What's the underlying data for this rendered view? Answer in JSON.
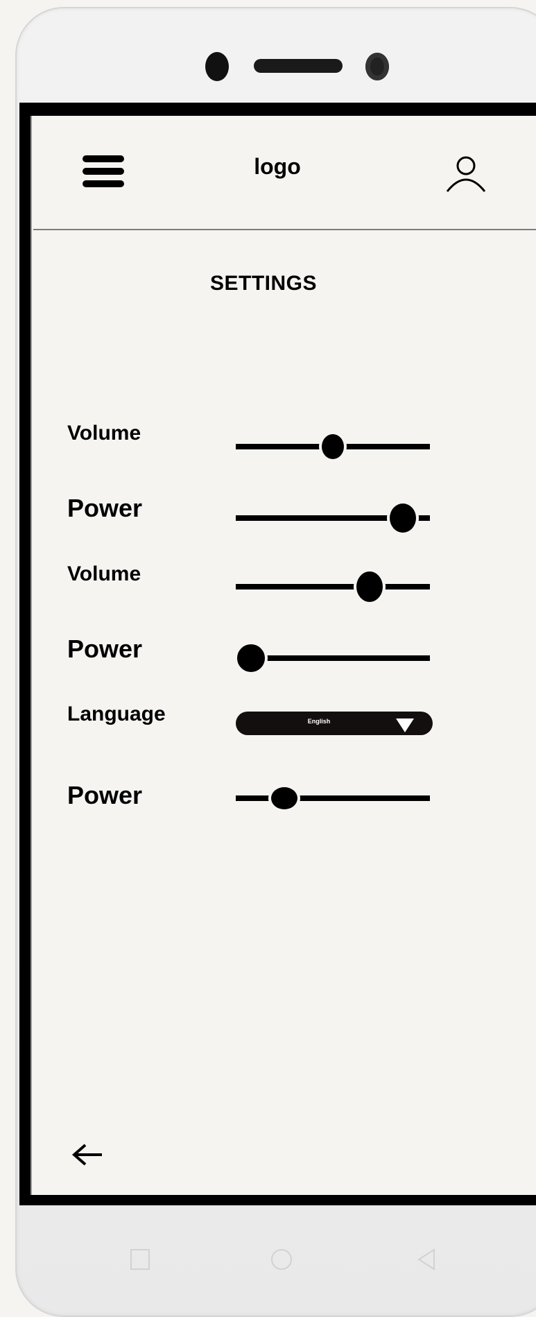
{
  "header": {
    "logo": "logo"
  },
  "page": {
    "title": "SETTINGS"
  },
  "settings": [
    {
      "label": "Volume",
      "type": "slider",
      "value": 0.5
    },
    {
      "label": "Power",
      "type": "slider",
      "value": 0.86
    },
    {
      "label": "Volume",
      "type": "slider",
      "value": 0.69
    },
    {
      "label": "Power",
      "type": "slider",
      "value": 0.08
    },
    {
      "label": "Language",
      "type": "dropdown",
      "selected": "English"
    },
    {
      "label": "Power",
      "type": "slider",
      "value": 0.25
    }
  ],
  "icons": {
    "menu": "hamburger-menu-icon",
    "user": "user-icon",
    "back": "back-arrow-icon",
    "dropdown": "dropdown-caret-icon",
    "nav_square": "recent-apps-icon",
    "nav_circle": "home-icon",
    "nav_triangle": "back-nav-icon"
  },
  "colors": {
    "background": "#f5f4f1",
    "slider": "#000000",
    "dropdown_bg": "#130f0e"
  }
}
